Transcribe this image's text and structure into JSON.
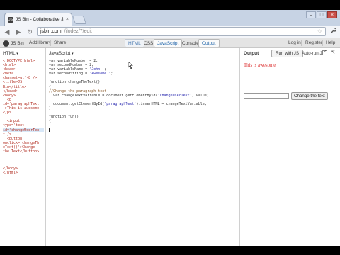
{
  "browser": {
    "tab_title": "JS Bin - Collaborative Jav...",
    "tab_close": "×",
    "favicon_text": "JS",
    "url_host": "jsbin.com",
    "url_path": "/ilodez/7/edit",
    "nav": {
      "back": "◀",
      "forward": "▶",
      "reload": "↻",
      "star": "☆",
      "wrench": "🔧"
    },
    "window_buttons": [
      "–",
      "□",
      "×"
    ]
  },
  "jsbin": {
    "brand": "JS Bin",
    "add_library": "Add library",
    "share": "Share",
    "panel_tabs": [
      "HTML",
      "CSS",
      "JavaScript",
      "Console",
      "Output"
    ],
    "log_in": "Log in",
    "register": "Register",
    "help": "Help"
  },
  "html_panel": {
    "label": "HTML",
    "caret": "▾",
    "lines": [
      "<!DOCTYPE html>",
      "<html>",
      "<head>",
      "<meta",
      "charset=utf-8 />",
      "<title>JS",
      "Bin</title>",
      "</head>",
      "<body>",
      "  <p",
      "id='paragraphText",
      "'>This is awesome",
      "</p>",
      "",
      "  <input",
      "type='text'",
      "id='changeUserTex",
      "t'/>",
      "  <button",
      "onclick='changeTh",
      "eText()'>Change",
      "the Text</button>",
      "",
      "",
      "",
      "</body>",
      "</html>"
    ]
  },
  "js_panel": {
    "label": "JavaScript",
    "caret": "▾",
    "lines": [
      "var variableNumber = 2;",
      "var secondNumber = 2;",
      "var variableName = 'John ';",
      "var secondString = 'Awesome ';",
      "",
      "function changeTheText()",
      "{",
      "//Change the paragraph text",
      "  var changeTextVariable = document.getElementById('changeUserText').value;",
      "",
      "  document.getElementById('paragraphText').innerHTML = changeTextVariable;",
      "}",
      "",
      "function fun()",
      "{",
      "",
      "}"
    ]
  },
  "output_panel": {
    "label": "Output",
    "run_button": "Run with JS",
    "autorun_label": "Auto-run JS",
    "autorun_checked": "✓",
    "popout_icon": "⇱",
    "paragraph": "This is awesome",
    "button_label": "Change the text"
  },
  "colors": {
    "tag": "#b02a1e",
    "string": "#2a2ab0",
    "output_text": "#dd3333"
  }
}
